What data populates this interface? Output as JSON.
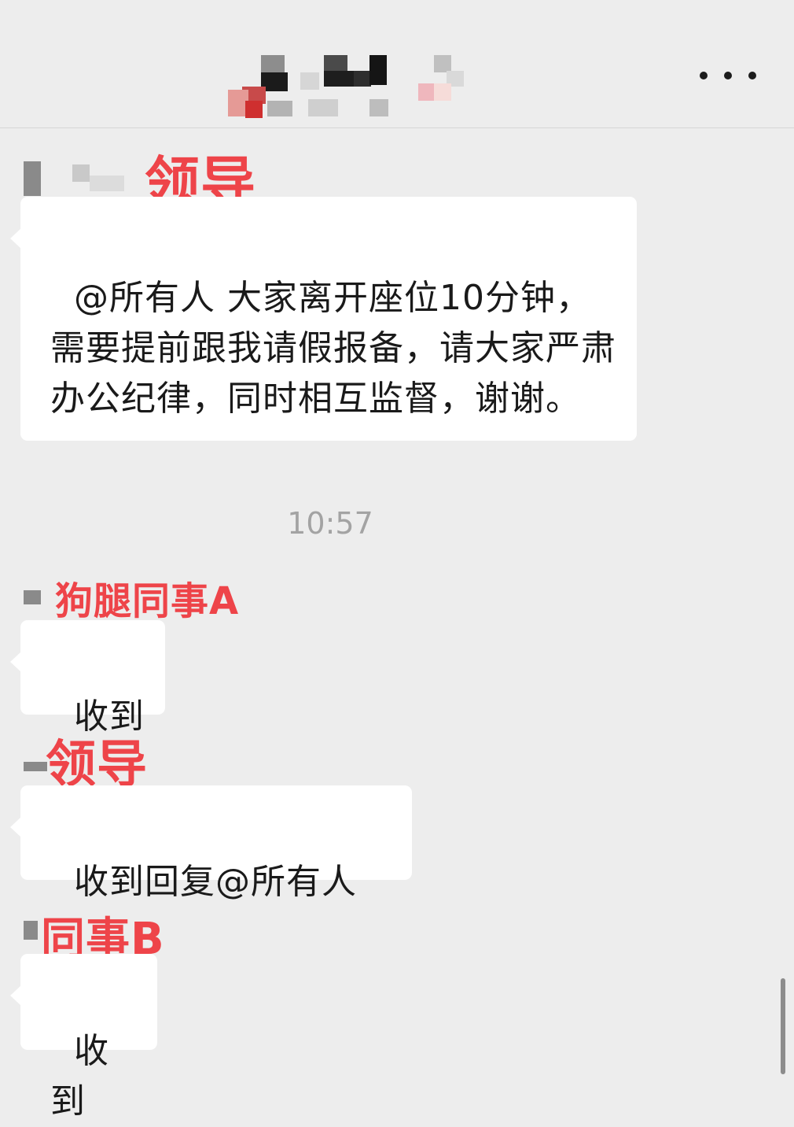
{
  "header": {
    "title_redacted": true,
    "more_icon": "more-dots-icon"
  },
  "messages": [
    {
      "sender_annotation": "领导",
      "text": "@所有人 大家离开座位10分钟，需要提前跟我请假报备，请大家严肃办公纪律，同时相互监督，谢谢。"
    },
    {
      "sender_annotation": "狗腿同事A",
      "text": "收到"
    },
    {
      "sender_annotation": "领导",
      "text": "收到回复@所有人"
    },
    {
      "sender_annotation": "同事B",
      "text": "收到"
    }
  ],
  "timestamp": "10:57",
  "colors": {
    "background": "#ededed",
    "bubble": "#ffffff",
    "annotation": "#ee4449",
    "timestamp": "#a3a3a3"
  }
}
